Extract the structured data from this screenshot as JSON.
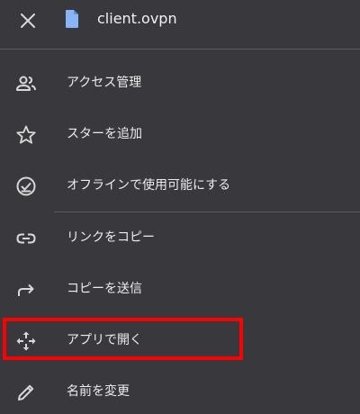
{
  "header": {
    "file_name": "client.ovpn",
    "close_icon": "close-icon",
    "file_icon": "document-icon"
  },
  "menu": {
    "items": [
      {
        "label": "アクセス管理",
        "icon": "people-icon"
      },
      {
        "label": "スターを追加",
        "icon": "star-icon"
      },
      {
        "label": "オフラインで使用可能にする",
        "icon": "offline-check-icon"
      },
      {
        "label": "リンクをコピー",
        "icon": "link-icon"
      },
      {
        "label": "コピーを送信",
        "icon": "share-arrow-icon"
      },
      {
        "label": "アプリで開く",
        "icon": "open-with-icon",
        "highlighted": true
      },
      {
        "label": "名前を変更",
        "icon": "pencil-icon"
      }
    ]
  },
  "colors": {
    "background": "#38383d",
    "text": "#ececec",
    "icon": "#d8d8d8",
    "file_icon": "#8ab4f8",
    "highlight": "#ff0000"
  }
}
